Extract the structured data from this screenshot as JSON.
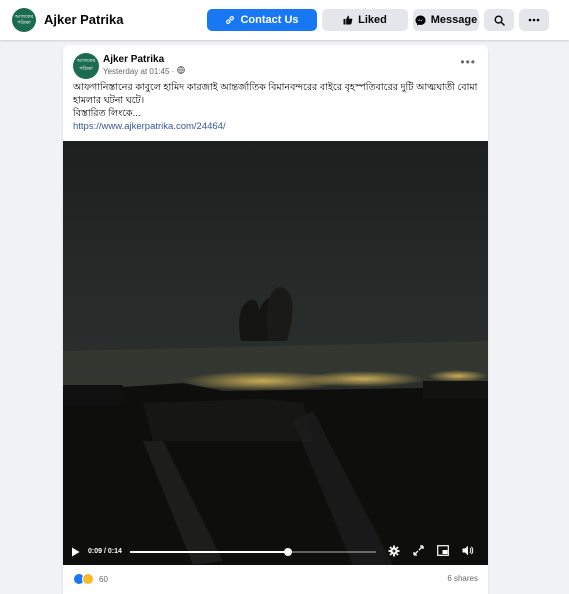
{
  "header": {
    "avatar_text": "আজকের পত্রিকা",
    "page_name": "Ajker Patrika",
    "contact_label": "Contact Us",
    "liked_label": "Liked",
    "message_label": "Message"
  },
  "post": {
    "author": "Ajker Patrika",
    "time": "Yesterday at 01:45 ·",
    "text_line": "আফগানিস্তানের কাবুলে হামিদ কারজাই আন্তর্জাতিক বিমানবন্দরের বাইরে বৃহস্পতিবারের দুটি আত্মঘাতী বোমা হামলার ঘটনা ঘটে।",
    "link_line": "বিস্তারিত লিংকে...",
    "url": "https://www.ajkerpatrika.com/24464/"
  },
  "video": {
    "time_display": "0:09 / 0:14",
    "progress": 0.6428
  },
  "footer": {
    "reaction_count": "60",
    "shares": "6 shares"
  },
  "colors": {
    "accent": "#1877f2",
    "brand_green": "#1a6b4f"
  },
  "icons": [
    "link-icon",
    "thumbs-up-icon",
    "messenger-icon",
    "search-icon",
    "more-icon",
    "globe-icon",
    "play-icon",
    "settings-icon",
    "fullscreen-icon",
    "pip-icon",
    "volume-icon"
  ]
}
